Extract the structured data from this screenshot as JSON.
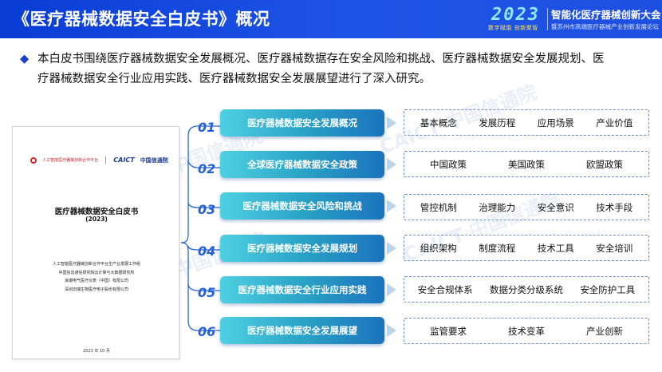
{
  "header": {
    "title": "《医疗器械数据安全白皮书》概况",
    "event_year": "2023",
    "event_tagline": "数字赋能  创新聚智",
    "event_name": "智能化医疗器械创新大会",
    "event_sub": "暨苏州市高端医疗器械产业创新发展论坛"
  },
  "intro": {
    "bullet": "◆",
    "line1": "本白皮书围绕医疗器械数据安全发展概况、医疗器械数据存在安全风险和挑战、医疗器械数据安全发展规划、医",
    "line2": "疗器械数据安全行业应用实践、医疗器械数据安全发展展望进行了深入研究。"
  },
  "cover": {
    "org_logo_text": "人工智能医疗器械创新合作平台",
    "caict_text": "CAICT",
    "caict_cn": "中国信通院",
    "title": "医疗器械数据安全白皮书",
    "year": "(2023)",
    "authors": [
      "人工智能医疗器械创新合作平台生产业发展工作组",
      "中国信息通信研究院云计算与大数据研究所",
      "浪潮电气医疗仪表（中国）有限公司",
      "深圳迈瑞生物医疗电子股份有限公司"
    ],
    "date": "2023 年 10 月"
  },
  "sections": [
    {
      "number": "01",
      "title": "医疗器械数据安全发展概况",
      "tags": [
        "基本概念",
        "发展历程",
        "应用场景",
        "产业价值"
      ]
    },
    {
      "number": "02",
      "title": "全球医疗器械数据安全政策",
      "tags": [
        "中国政策",
        "美国政策",
        "欧盟政策"
      ]
    },
    {
      "number": "03",
      "title": "医疗器械数据安全风险和挑战",
      "tags": [
        "管控机制",
        "治理能力",
        "安全意识",
        "技术手段"
      ]
    },
    {
      "number": "04",
      "title": "医疗器械数据安全发展规划",
      "tags": [
        "组织架构",
        "制度流程",
        "技术工具",
        "安全培训"
      ]
    },
    {
      "number": "05",
      "title": "医疗器械数据安全行业应用实践",
      "tags": [
        "安全合规体系",
        "数据分类分级系统",
        "安全防护工具"
      ]
    },
    {
      "number": "06",
      "title": "医疗器械数据安全发展展望",
      "tags": [
        "监管要求",
        "技术变革",
        "产业创新"
      ]
    }
  ],
  "watermarks": [
    "中国信通院",
    "CAICT 中国信通院",
    "CAICT 中国信通院",
    "中国信通院"
  ],
  "colors": {
    "header_bg": "#1f55e6",
    "pill_start": "#4fd0e2",
    "pill_end": "#1b73bd",
    "number": "#2260d8",
    "tag_border": "#6a8ed0"
  }
}
